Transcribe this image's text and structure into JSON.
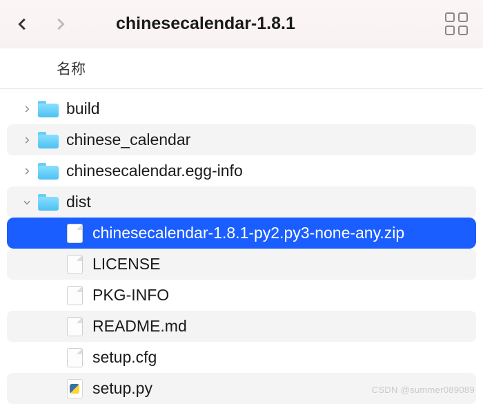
{
  "header": {
    "title": "chinesecalendar-1.8.1",
    "column_label": "名称"
  },
  "items": [
    {
      "name": "build",
      "type": "folder",
      "depth": 0,
      "expanded": false,
      "selected": false,
      "alt": false
    },
    {
      "name": "chinese_calendar",
      "type": "folder",
      "depth": 0,
      "expanded": false,
      "selected": false,
      "alt": true
    },
    {
      "name": "chinesecalendar.egg-info",
      "type": "folder",
      "depth": 0,
      "expanded": false,
      "selected": false,
      "alt": false
    },
    {
      "name": "dist",
      "type": "folder",
      "depth": 0,
      "expanded": true,
      "selected": false,
      "alt": true
    },
    {
      "name": "chinesecalendar-1.8.1-py2.py3-none-any.zip",
      "type": "file",
      "depth": 1,
      "expanded": null,
      "selected": true,
      "alt": false
    },
    {
      "name": "LICENSE",
      "type": "file",
      "depth": 1,
      "expanded": null,
      "selected": false,
      "alt": true
    },
    {
      "name": "PKG-INFO",
      "type": "file",
      "depth": 1,
      "expanded": null,
      "selected": false,
      "alt": false
    },
    {
      "name": "README.md",
      "type": "file",
      "depth": 1,
      "expanded": null,
      "selected": false,
      "alt": true
    },
    {
      "name": "setup.cfg",
      "type": "file",
      "depth": 1,
      "expanded": null,
      "selected": false,
      "alt": false
    },
    {
      "name": "setup.py",
      "type": "python",
      "depth": 1,
      "expanded": null,
      "selected": false,
      "alt": true
    }
  ],
  "watermark": "CSDN @summer089089"
}
